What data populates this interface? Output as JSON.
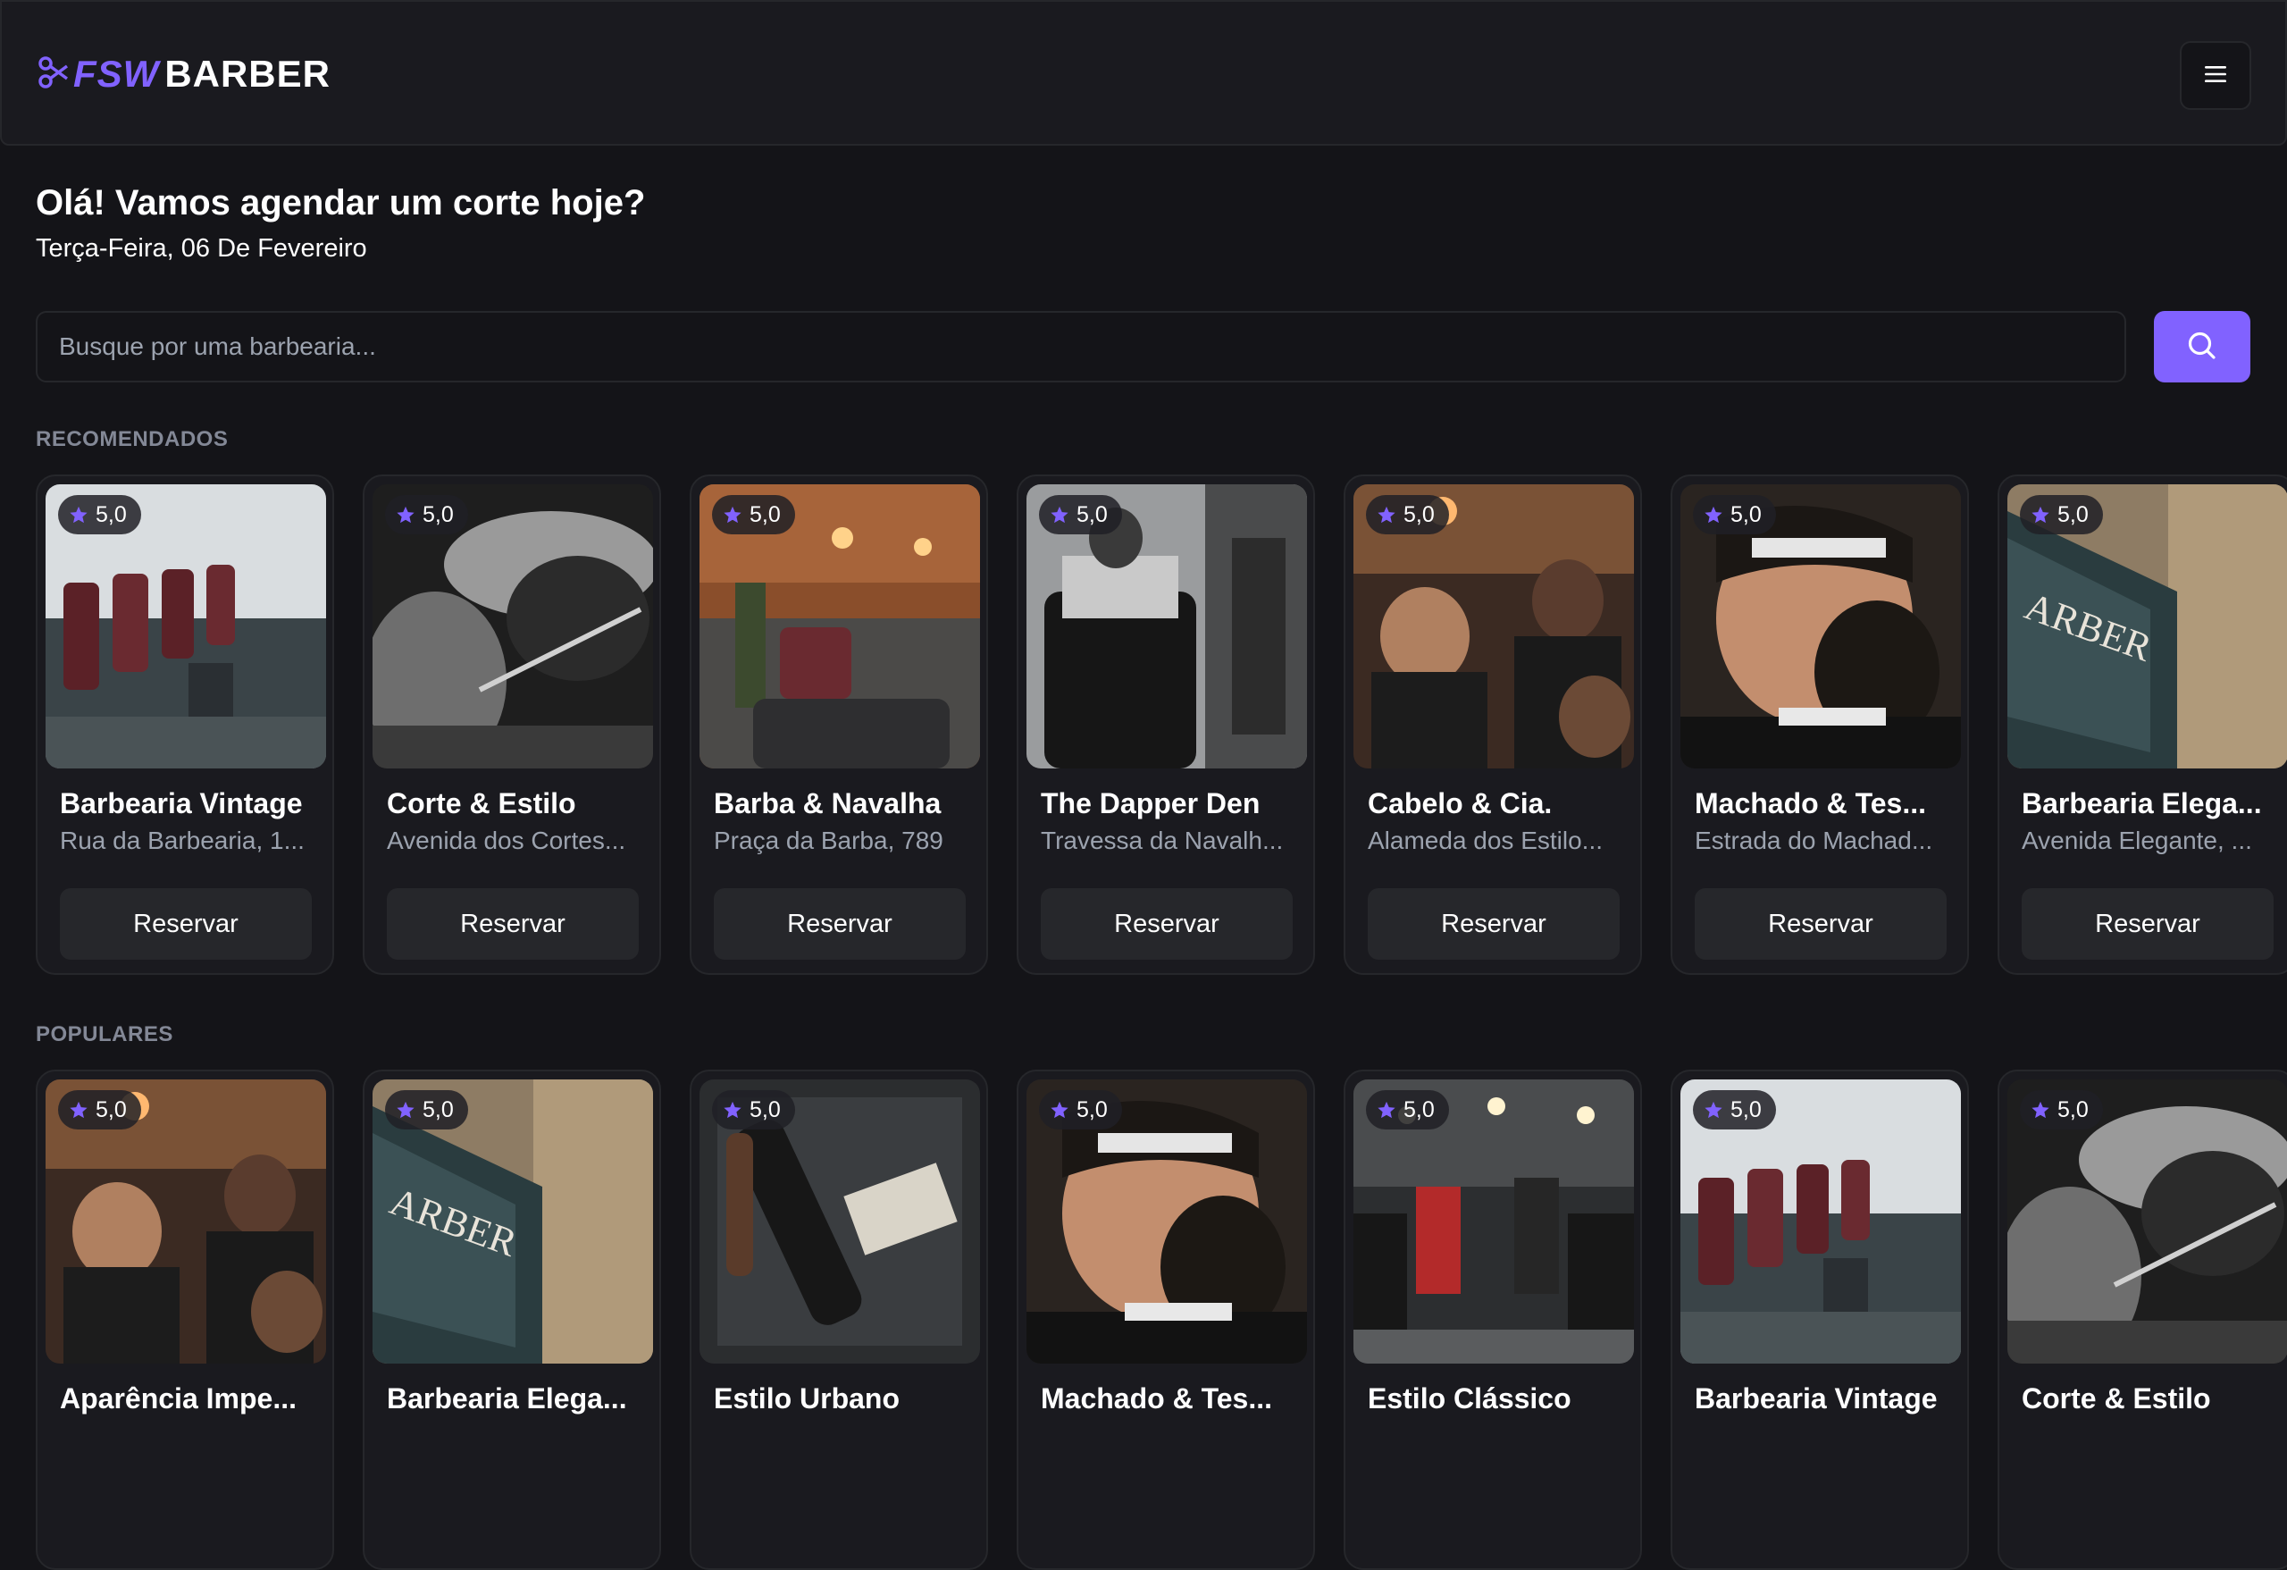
{
  "header": {
    "logo_primary": "FSW",
    "logo_secondary": "BARBER",
    "menu_icon": "menu-icon",
    "accent_color": "#8162ff"
  },
  "welcome": {
    "greeting": "Olá! Vamos agendar um corte hoje?",
    "date": "Terça-Feira, 06 De Fevereiro"
  },
  "search": {
    "placeholder": "Busque por uma barbearia...",
    "value": "",
    "button_icon": "search-icon"
  },
  "recommended": {
    "title": "RECOMENDADOS",
    "cards": [
      {
        "name": "Barbearia Vintage",
        "address": "Rua da Barbearia, 1...",
        "rating": "5,0",
        "button": "Reservar",
        "image_theme": "shop-chairs"
      },
      {
        "name": "Corte & Estilo",
        "address": "Avenida dos Cortes...",
        "rating": "5,0",
        "button": "Reservar",
        "image_theme": "beard-trim-bw"
      },
      {
        "name": "Barba & Navalha",
        "address": "Praça da Barba, 789",
        "rating": "5,0",
        "button": "Reservar",
        "image_theme": "brick-shop"
      },
      {
        "name": "The Dapper Den",
        "address": "Travessa da Navalh...",
        "rating": "5,0",
        "button": "Reservar",
        "image_theme": "barber-chair"
      },
      {
        "name": "Cabelo & Cia.",
        "address": "Alameda dos Estilo...",
        "rating": "5,0",
        "button": "Reservar",
        "image_theme": "busy-shop"
      },
      {
        "name": "Machado & Tes...",
        "address": "Estrada do Machad...",
        "rating": "5,0",
        "button": "Reservar",
        "image_theme": "haircut-closeup"
      },
      {
        "name": "Barbearia Elega...",
        "address": "Avenida Elegante, ...",
        "rating": "5,0",
        "button": "Reservar",
        "image_theme": "shop-sign"
      }
    ]
  },
  "popular": {
    "title": "POPULARES",
    "cards": [
      {
        "name": "Aparência Impe...",
        "rating": "5,0",
        "image_theme": "busy-shop"
      },
      {
        "name": "Barbearia Elega...",
        "rating": "5,0",
        "image_theme": "shop-sign"
      },
      {
        "name": "Estilo Urbano",
        "rating": "5,0",
        "image_theme": "tools"
      },
      {
        "name": "Machado & Tes...",
        "rating": "5,0",
        "image_theme": "haircut-closeup"
      },
      {
        "name": "Estilo Clássico",
        "rating": "5,0",
        "image_theme": "barbers-at-work"
      },
      {
        "name": "Barbearia Vintage",
        "rating": "5,0",
        "image_theme": "shop-chairs"
      },
      {
        "name": "Corte & Estilo",
        "rating": "5,0",
        "image_theme": "beard-trim-bw"
      }
    ]
  }
}
